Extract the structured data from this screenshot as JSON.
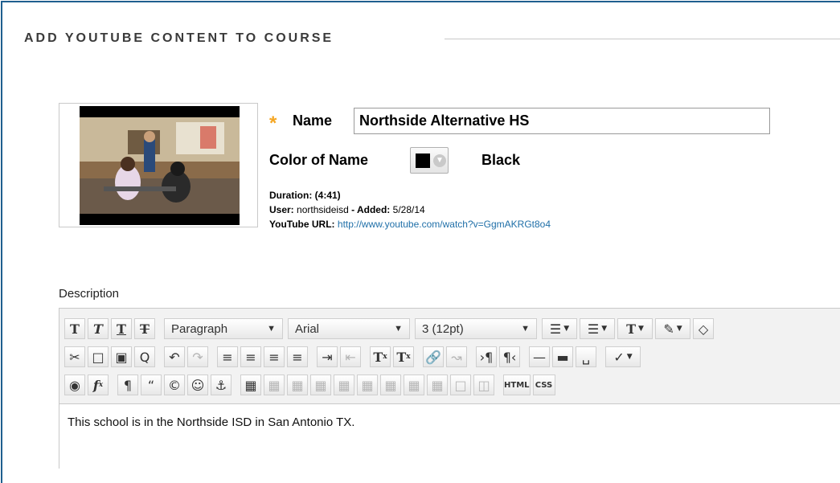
{
  "section": {
    "title": "ADD YOUTUBE CONTENT TO COURSE"
  },
  "video": {
    "name_label": "Name",
    "name_value": "Northside Alternative HS",
    "required_mark": "*",
    "color_label": "Color of Name",
    "color_value": "Black",
    "color_hex": "#000000",
    "duration_label": "Duration:",
    "duration_value": "(4:41)",
    "user_label": "User:",
    "user_value": "northsideisd",
    "added_label": "- Added:",
    "added_value": "5/28/14",
    "url_label": "YouTube URL:",
    "url_value": "http://www.youtube.com/watch?v=GgmAKRGt8o4"
  },
  "description": {
    "label": "Description",
    "format_select": "Paragraph",
    "font_select": "Arial",
    "size_select": "3 (12pt)",
    "body_text": "This school is in the Northside ISD in San Antonio TX."
  },
  "toolbar": {
    "html_label": "HTML",
    "css_label": "CSS"
  },
  "colors": {
    "accent": "#1f5f8f",
    "required": "#f5a623",
    "link": "#1f6fa8"
  }
}
